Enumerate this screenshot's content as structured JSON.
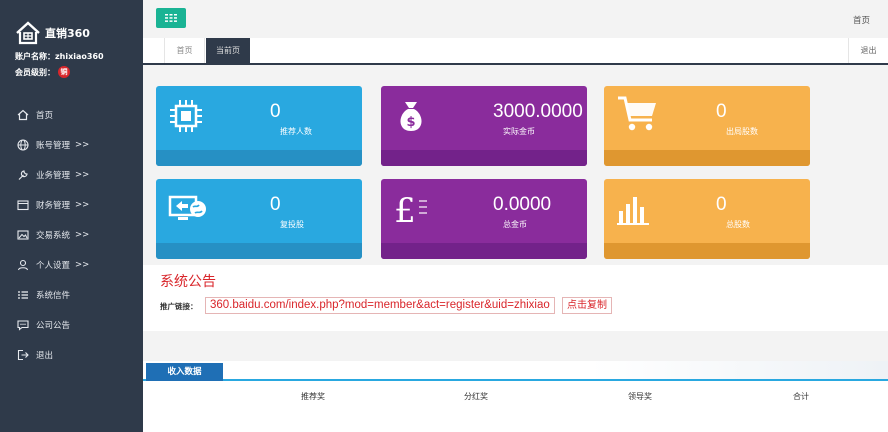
{
  "sidebar": {
    "brand": "直销360",
    "account_label": "账户名称：zhixiao360",
    "level_label": "会员级别：",
    "level_badge": "铜",
    "items": [
      {
        "label": "首页",
        "arrow": ""
      },
      {
        "label": "账号管理",
        "arrow": ">>"
      },
      {
        "label": "业务管理",
        "arrow": ">>"
      },
      {
        "label": "财务管理",
        "arrow": ">>"
      },
      {
        "label": "交易系统",
        "arrow": ">>"
      },
      {
        "label": "个人设置",
        "arrow": ">>"
      },
      {
        "label": "系统信件",
        "arrow": ""
      },
      {
        "label": "公司公告",
        "arrow": ""
      },
      {
        "label": "退出",
        "arrow": ""
      }
    ]
  },
  "topbar": {
    "home_link": "首页"
  },
  "tabs": {
    "home": "首页",
    "current": "当前页",
    "exit": "退出"
  },
  "cards": [
    {
      "value": "0",
      "label": "推荐人数",
      "icon": "chip-icon"
    },
    {
      "value": "3000.0000",
      "label": "实际金币",
      "icon": "money-bag-icon"
    },
    {
      "value": "0",
      "label": "出局股数",
      "icon": "cart-icon"
    },
    {
      "value": "0",
      "label": "复投股",
      "icon": "monitor-globe-icon"
    },
    {
      "value": "0.0000",
      "label": "总金币",
      "icon": "pound-icon"
    },
    {
      "value": "0",
      "label": "总股数",
      "icon": "bar-chart-icon"
    }
  ],
  "notice": {
    "title": "系统公告",
    "link_label": "推广链接：",
    "link": "360.baidu.com/index.php?mod=member&act=register&uid=zhixiao",
    "copy_button": "点击复制"
  },
  "income": {
    "tab": "收入数据",
    "columns": [
      "推荐奖",
      "分红奖",
      "领导奖",
      "合计"
    ]
  },
  "colors": {
    "sidebar": "#2f3a4a",
    "blue": "#29a8e0",
    "purple": "#8a2c9c",
    "orange": "#f7b24d",
    "accent_red": "#d9262b",
    "teal": "#1ab394"
  }
}
